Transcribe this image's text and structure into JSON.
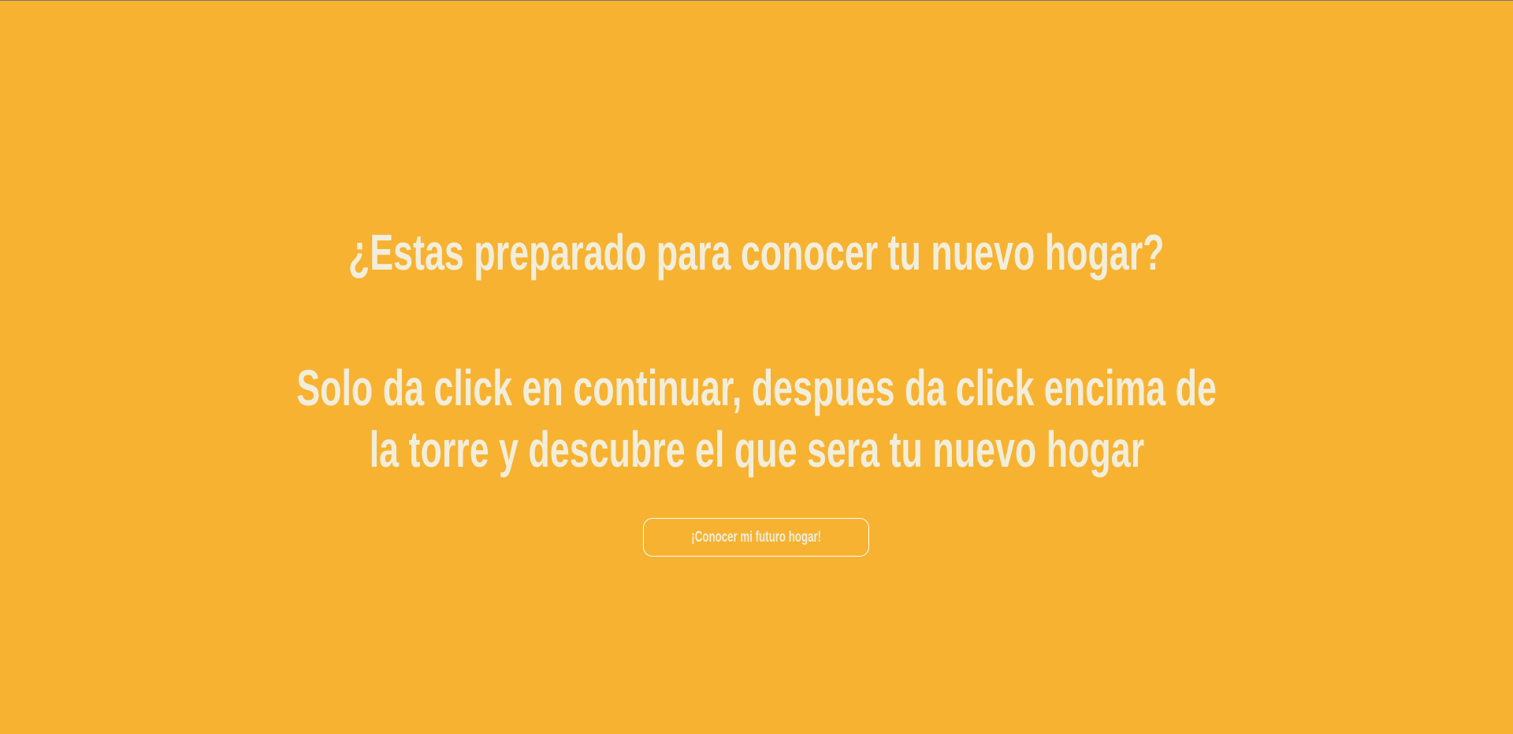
{
  "colors": {
    "background": "#f7b231",
    "text": "#f3eedb",
    "button_border": "#ffffff"
  },
  "main": {
    "heading": "¿Estas preparado para conocer tu nuevo hogar?",
    "instructions_line1": "Solo da click en continuar, despues da click encima de",
    "instructions_line2": "la torre y descubre el que sera tu nuevo hogar",
    "button_label": "¡Conocer mi futuro hogar!"
  }
}
